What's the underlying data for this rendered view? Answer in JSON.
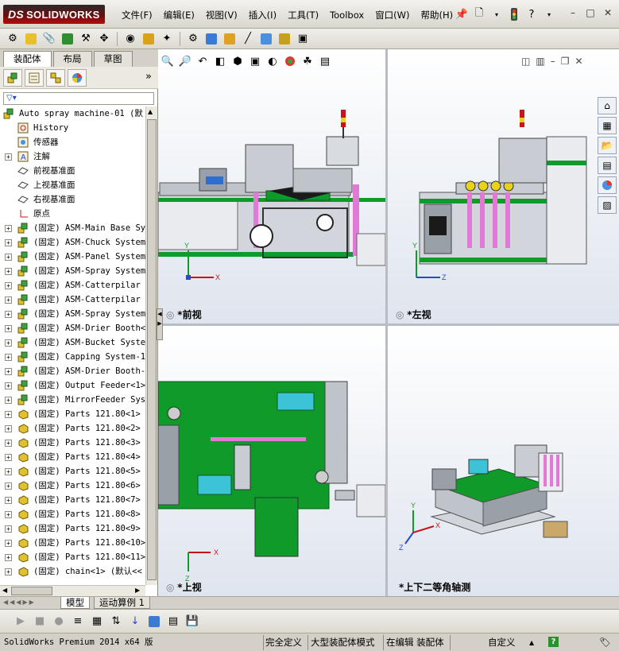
{
  "app": {
    "brand": "SOLIDWORKS",
    "brand_prefix": "DS"
  },
  "menu": {
    "items": [
      "文件(F)",
      "编辑(E)",
      "视图(V)",
      "插入(I)",
      "工具(T)",
      "Toolbox",
      "窗口(W)",
      "帮助(H)"
    ]
  },
  "feature_manager": {
    "tabs": [
      "装配体",
      "布局",
      "草图"
    ],
    "more_glyph": "»",
    "tree": [
      {
        "label": "Auto spray machine-01  (默",
        "expander": "",
        "icon": "assembly-root-icon",
        "depth": 0
      },
      {
        "label": "History",
        "expander": "",
        "icon": "history-icon",
        "depth": 1
      },
      {
        "label": "传感器",
        "expander": "",
        "icon": "sensor-icon",
        "depth": 1
      },
      {
        "label": "注解",
        "expander": "+",
        "icon": "annotation-icon",
        "depth": 1
      },
      {
        "label": "前视基准面",
        "expander": "",
        "icon": "plane-icon",
        "depth": 1
      },
      {
        "label": "上视基准面",
        "expander": "",
        "icon": "plane-icon",
        "depth": 1
      },
      {
        "label": "右视基准面",
        "expander": "",
        "icon": "plane-icon",
        "depth": 1
      },
      {
        "label": "原点",
        "expander": "",
        "icon": "origin-icon",
        "depth": 1
      },
      {
        "label": "(固定) ASM-Main Base Sy",
        "expander": "+",
        "icon": "subassembly-icon",
        "depth": 1
      },
      {
        "label": "(固定) ASM-Chuck System",
        "expander": "+",
        "icon": "subassembly-icon",
        "depth": 1
      },
      {
        "label": "(固定) ASM-Panel System",
        "expander": "+",
        "icon": "subassembly-icon",
        "depth": 1
      },
      {
        "label": "(固定) ASM-Spray System",
        "expander": "+",
        "icon": "subassembly-icon",
        "depth": 1
      },
      {
        "label": "(固定) ASM-Catterpilar",
        "expander": "+",
        "icon": "subassembly-icon",
        "depth": 1
      },
      {
        "label": "(固定) ASM-Catterpilar",
        "expander": "+",
        "icon": "subassembly-icon",
        "depth": 1
      },
      {
        "label": "(固定) ASM-Spray System",
        "expander": "+",
        "icon": "subassembly-icon",
        "depth": 1
      },
      {
        "label": "(固定) ASM-Drier Booth<",
        "expander": "+",
        "icon": "subassembly-icon",
        "depth": 1
      },
      {
        "label": "(固定) ASM-Bucket Syste",
        "expander": "+",
        "icon": "subassembly-icon",
        "depth": 1
      },
      {
        "label": "(固定) Capping System-1",
        "expander": "+",
        "icon": "subassembly-icon",
        "depth": 1
      },
      {
        "label": "(固定) ASM-Drier Booth-",
        "expander": "+",
        "icon": "subassembly-icon",
        "depth": 1
      },
      {
        "label": "(固定) Output Feeder<1>",
        "expander": "+",
        "icon": "subassembly-icon",
        "depth": 1
      },
      {
        "label": "(固定) MirrorFeeder Sys",
        "expander": "+",
        "icon": "subassembly-icon",
        "depth": 1
      },
      {
        "label": "(固定) Parts 121.80<1>",
        "expander": "+",
        "icon": "part-icon",
        "depth": 1
      },
      {
        "label": "(固定) Parts 121.80<2>",
        "expander": "+",
        "icon": "part-icon",
        "depth": 1
      },
      {
        "label": "(固定) Parts 121.80<3>",
        "expander": "+",
        "icon": "part-icon",
        "depth": 1
      },
      {
        "label": "(固定) Parts 121.80<4>",
        "expander": "+",
        "icon": "part-icon",
        "depth": 1
      },
      {
        "label": "(固定) Parts 121.80<5>",
        "expander": "+",
        "icon": "part-icon",
        "depth": 1
      },
      {
        "label": "(固定) Parts 121.80<6>",
        "expander": "+",
        "icon": "part-icon",
        "depth": 1
      },
      {
        "label": "(固定) Parts 121.80<7>",
        "expander": "+",
        "icon": "part-icon",
        "depth": 1
      },
      {
        "label": "(固定) Parts 121.80<8>",
        "expander": "+",
        "icon": "part-icon",
        "depth": 1
      },
      {
        "label": "(固定) Parts 121.80<9>",
        "expander": "+",
        "icon": "part-icon",
        "depth": 1
      },
      {
        "label": "(固定) Parts 121.80<10>",
        "expander": "+",
        "icon": "part-icon",
        "depth": 1
      },
      {
        "label": "(固定) Parts 121.80<11>",
        "expander": "+",
        "icon": "part-icon",
        "depth": 1
      },
      {
        "label": "(固定) chain<1> (默认<<",
        "expander": "+",
        "icon": "part-icon",
        "depth": 1
      }
    ]
  },
  "viewports": {
    "front": {
      "label": "*前视",
      "axis_a": "Y",
      "axis_b": "X"
    },
    "left": {
      "label": "*左视",
      "axis_a": "Y",
      "axis_b": "Z"
    },
    "top": {
      "label": "*上视",
      "axis_a": "X",
      "axis_b": "Z"
    },
    "iso": {
      "label": "*上下二等角轴测",
      "axis_a": "Y",
      "axis_b": "X",
      "axis_c": "Z"
    }
  },
  "bottom_tabs": [
    "模型",
    "运动算例 1"
  ],
  "status": {
    "product": "SolidWorks Premium 2014 x64 版",
    "definition": "完全定义",
    "mode": "大型装配体模式",
    "editing": "在编辑 装配体",
    "units": "自定义",
    "units_arrow": "▲",
    "help_glyph": "?"
  },
  "colors": {
    "machine_green": "#0f9a2a",
    "accent_red": "#c8141b",
    "frame_gray": "#8a8f97",
    "pink_tubes": "#e07ad6"
  }
}
